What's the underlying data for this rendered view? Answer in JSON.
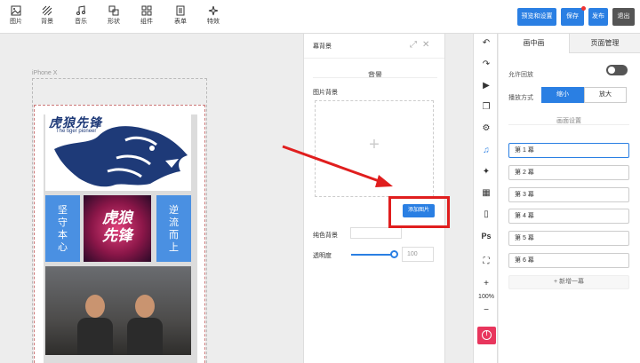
{
  "toolbar": {
    "tools": [
      {
        "label": "图片",
        "icon": "image-icon"
      },
      {
        "label": "背景",
        "icon": "background-icon"
      },
      {
        "label": "音乐",
        "icon": "music-icon"
      },
      {
        "label": "形状",
        "icon": "shape-icon"
      },
      {
        "label": "组件",
        "icon": "component-icon"
      },
      {
        "label": "表单",
        "icon": "form-icon"
      },
      {
        "label": "特效",
        "icon": "effects-icon"
      }
    ],
    "preview_label": "预览和设置",
    "save_label": "保存",
    "publish_label": "发布",
    "exit_label": "退出"
  },
  "canvas": {
    "device_label": "iPhone X",
    "brand_title": "虎狼先锋",
    "brand_subtitle": "The tiger pioneer",
    "left_card_text": "坚\n守\n本\n心",
    "right_card_text": "逆\n流\n而\n上",
    "center_card_text": "虎狼\n先锋"
  },
  "background_panel": {
    "title": "幕背景",
    "section_title": "背景",
    "image_bg_label": "图片背景",
    "add_image_label": "添加图片",
    "solid_bg_label": "纯色背景",
    "opacity_label": "透明度",
    "opacity_value": "100",
    "opacity_level": 1.0
  },
  "vertical_bar": {
    "icons": [
      "undo-icon",
      "redo-icon",
      "play-icon",
      "copy-icon",
      "settings-icon",
      "music-icon",
      "sparkle-icon",
      "grid-icon",
      "phone-icon",
      "ps-icon",
      "scan-icon"
    ],
    "ps_label": "Ps",
    "zoom_level": "100%"
  },
  "right_panel": {
    "tab_active": "画中画",
    "tab_inactive": "页面管理",
    "allow_loop_label": "允许回放",
    "allow_loop_on": false,
    "play_mode_label": "播放方式",
    "mode_shrink": "缩小",
    "mode_enlarge": "放大",
    "screen_settings_label": "画面设置",
    "scenes": [
      "第 1 幕",
      "第 2 幕",
      "第 3 幕",
      "第 4 幕",
      "第 5 幕",
      "第 6 幕"
    ],
    "add_scene_label": "+ 新增一幕"
  },
  "colors": {
    "accent": "#2a7fe3",
    "highlight": "#e01e1e",
    "info_button": "#e8365d"
  }
}
